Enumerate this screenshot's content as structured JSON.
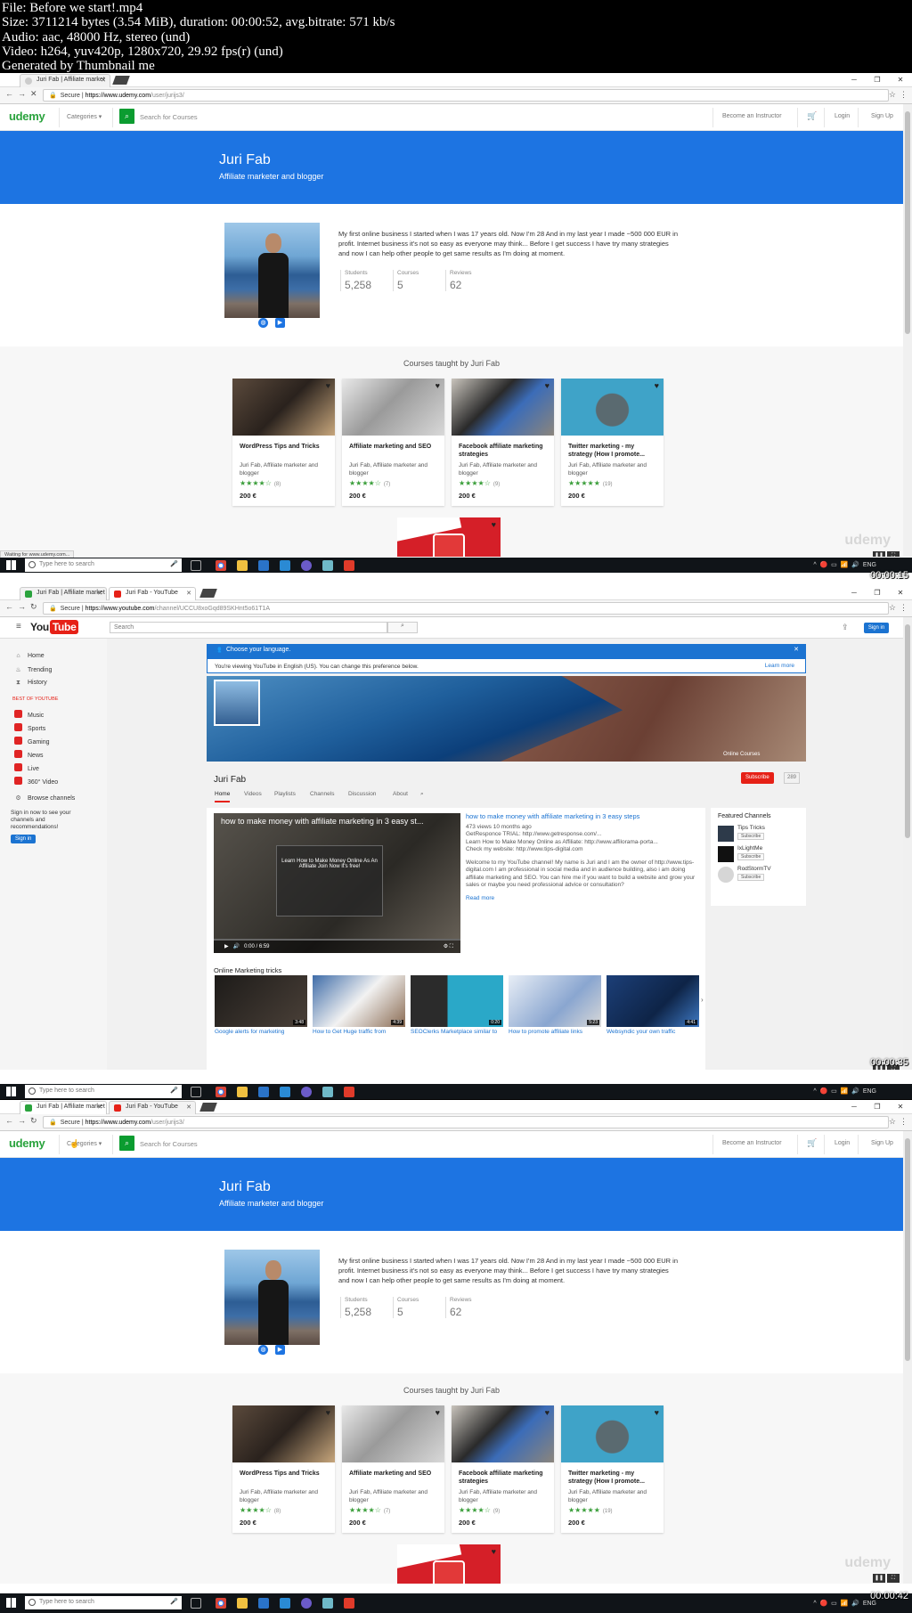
{
  "file_info": {
    "line1": "File: Before we start!.mp4",
    "line2": "Size: 3711214 bytes (3.54 MiB), duration: 00:00:52, avg.bitrate: 571 kb/s",
    "line3": "Audio: aac, 48000 Hz, stereo (und)",
    "line4": "Video: h264, yuv420p, 1280x720, 29.92 fps(r) (und)",
    "line5": "Generated by Thumbnail me"
  },
  "browser": {
    "tab_udemy": "Juri Fab | Affiliate market",
    "tab_youtube": "Juri Fab - YouTube",
    "secure": "Secure",
    "url_udemy_host": "https://www.udemy.com",
    "url_udemy_path": "/user/jurijs3/",
    "url_youtube_host": "https://www.youtube.com",
    "url_youtube_path": "/channel/UCCU8xoGqd89SKHnt5o61T1A",
    "status_loading": "Waiting for www.udemy.com..."
  },
  "udemy": {
    "logo": "udemy",
    "categories": "Categories ▾",
    "search_placeholder": "Search for Courses",
    "become_instructor": "Become an Instructor",
    "login": "Login",
    "signup": "Sign Up",
    "name": "Juri Fab",
    "headline": "Affiliate marketer and blogger",
    "bio": "My first online business I started when I was 17 years old. Now I'm 28 And in my last year I made ~500 000 EUR in profit. Internet business it's not so easy as everyone may think... Before I get success I have try many strategies and now I can help other people to get same results as I'm doing at moment.",
    "stats": [
      {
        "label": "Students",
        "value": "5,258"
      },
      {
        "label": "Courses",
        "value": "5"
      },
      {
        "label": "Reviews",
        "value": "62"
      }
    ],
    "courses_heading": "Courses taught by Juri Fab",
    "courses": [
      {
        "title": "WordPress Tips and Tricks",
        "author": "Juri Fab, Affiliate marketer and blogger",
        "stars": "★★★★☆",
        "count": "(8)",
        "price": "200 €"
      },
      {
        "title": "Affiliate marketing and SEO",
        "author": "Juri Fab, Affiliate marketer and blogger",
        "stars": "★★★★☆",
        "count": "(7)",
        "price": "200 €"
      },
      {
        "title": "Facebook affiliate marketing strategies",
        "author": "Juri Fab, Affiliate marketer and blogger",
        "stars": "★★★★☆",
        "count": "(9)",
        "price": "200 €"
      },
      {
        "title": "Twitter marketing - my strategy (How I promote...",
        "author": "Juri Fab, Affiliate marketer and blogger",
        "stars": "★★★★★",
        "count": "(19)",
        "price": "200 €"
      }
    ]
  },
  "youtube": {
    "logo": "You",
    "logo_tube": "Tube",
    "search_placeholder": "Search",
    "sign_in": "Sign in",
    "side_home": "Home",
    "side_trending": "Trending",
    "side_history": "History",
    "best_of": "BEST OF YOUTUBE",
    "side_music": "Music",
    "side_sports": "Sports",
    "side_gaming": "Gaming",
    "side_news": "News",
    "side_live": "Live",
    "side_360": "360° Video",
    "browse_channels": "Browse channels",
    "signin_prompt": "Sign in now to see your channels and recommendations!",
    "lang_title": "Choose your language.",
    "lang_text": "You're viewing YouTube in English (US). You can change this preference below.",
    "learn_more": "Learn more",
    "banner_text": "Online Courses",
    "channel_name": "Juri Fab",
    "subscribe": "Subscribe",
    "sub_count": "289",
    "tabs": [
      "Home",
      "Videos",
      "Playlists",
      "Channels",
      "Discussion",
      "About"
    ],
    "video_title": "how to make money with affiliate marketing in 3 easy st...",
    "video_card": "Learn How to Make Money Online As An Affiliate Join Now It's free!",
    "video_time": "0:00 / 6:59",
    "desc_title": "how to make money with affiliate marketing in 3 easy steps",
    "desc_meta": "473 views  10 months ago",
    "desc_l1": "GetResponce TRIAL: http://www.getresponse.com/...",
    "desc_l2": "Learn How to Make Money Online as Affiliate: http://www.affilorama-porta...",
    "desc_l3": "Check my website: http://www.tips-digital.com",
    "desc_body": "Welcome to my YouTube channel! My name is Juri and I am the owner of http://www.tips-digital.com I am professional in social media and in audience building, also i am doing affiliate marketing and SEO. You can hire me if you want to build a website and grow your sales or maybe you need professional advice or consultation?",
    "read_more": "Read more",
    "featured_heading": "Featured Channels",
    "featured": [
      {
        "name": "Tips Tricks",
        "btn": "Subscribe"
      },
      {
        "name": "IxLightMe",
        "btn": "Subscribe"
      },
      {
        "name": "RodStormTV",
        "btn": "Subscribe"
      }
    ],
    "shelf_title": "Online Marketing tricks",
    "thumbs": [
      {
        "label": "Google alerts for marketing",
        "dur": "3:48"
      },
      {
        "label": "How to Get Huge traffic from",
        "dur": "4:39"
      },
      {
        "label": "SEOClerks Marketplace similar to",
        "dur": "0:20"
      },
      {
        "label": "How to promote affiliate links",
        "dur": "5:23"
      },
      {
        "label": "Websyndic your own traffic",
        "dur": "4:41"
      }
    ]
  },
  "taskbar": {
    "search": "Type here to search",
    "lang": "ENG"
  },
  "timestamps": [
    "00:00:15",
    "00:00:35",
    "00:00:42"
  ],
  "watermark": "udemy"
}
